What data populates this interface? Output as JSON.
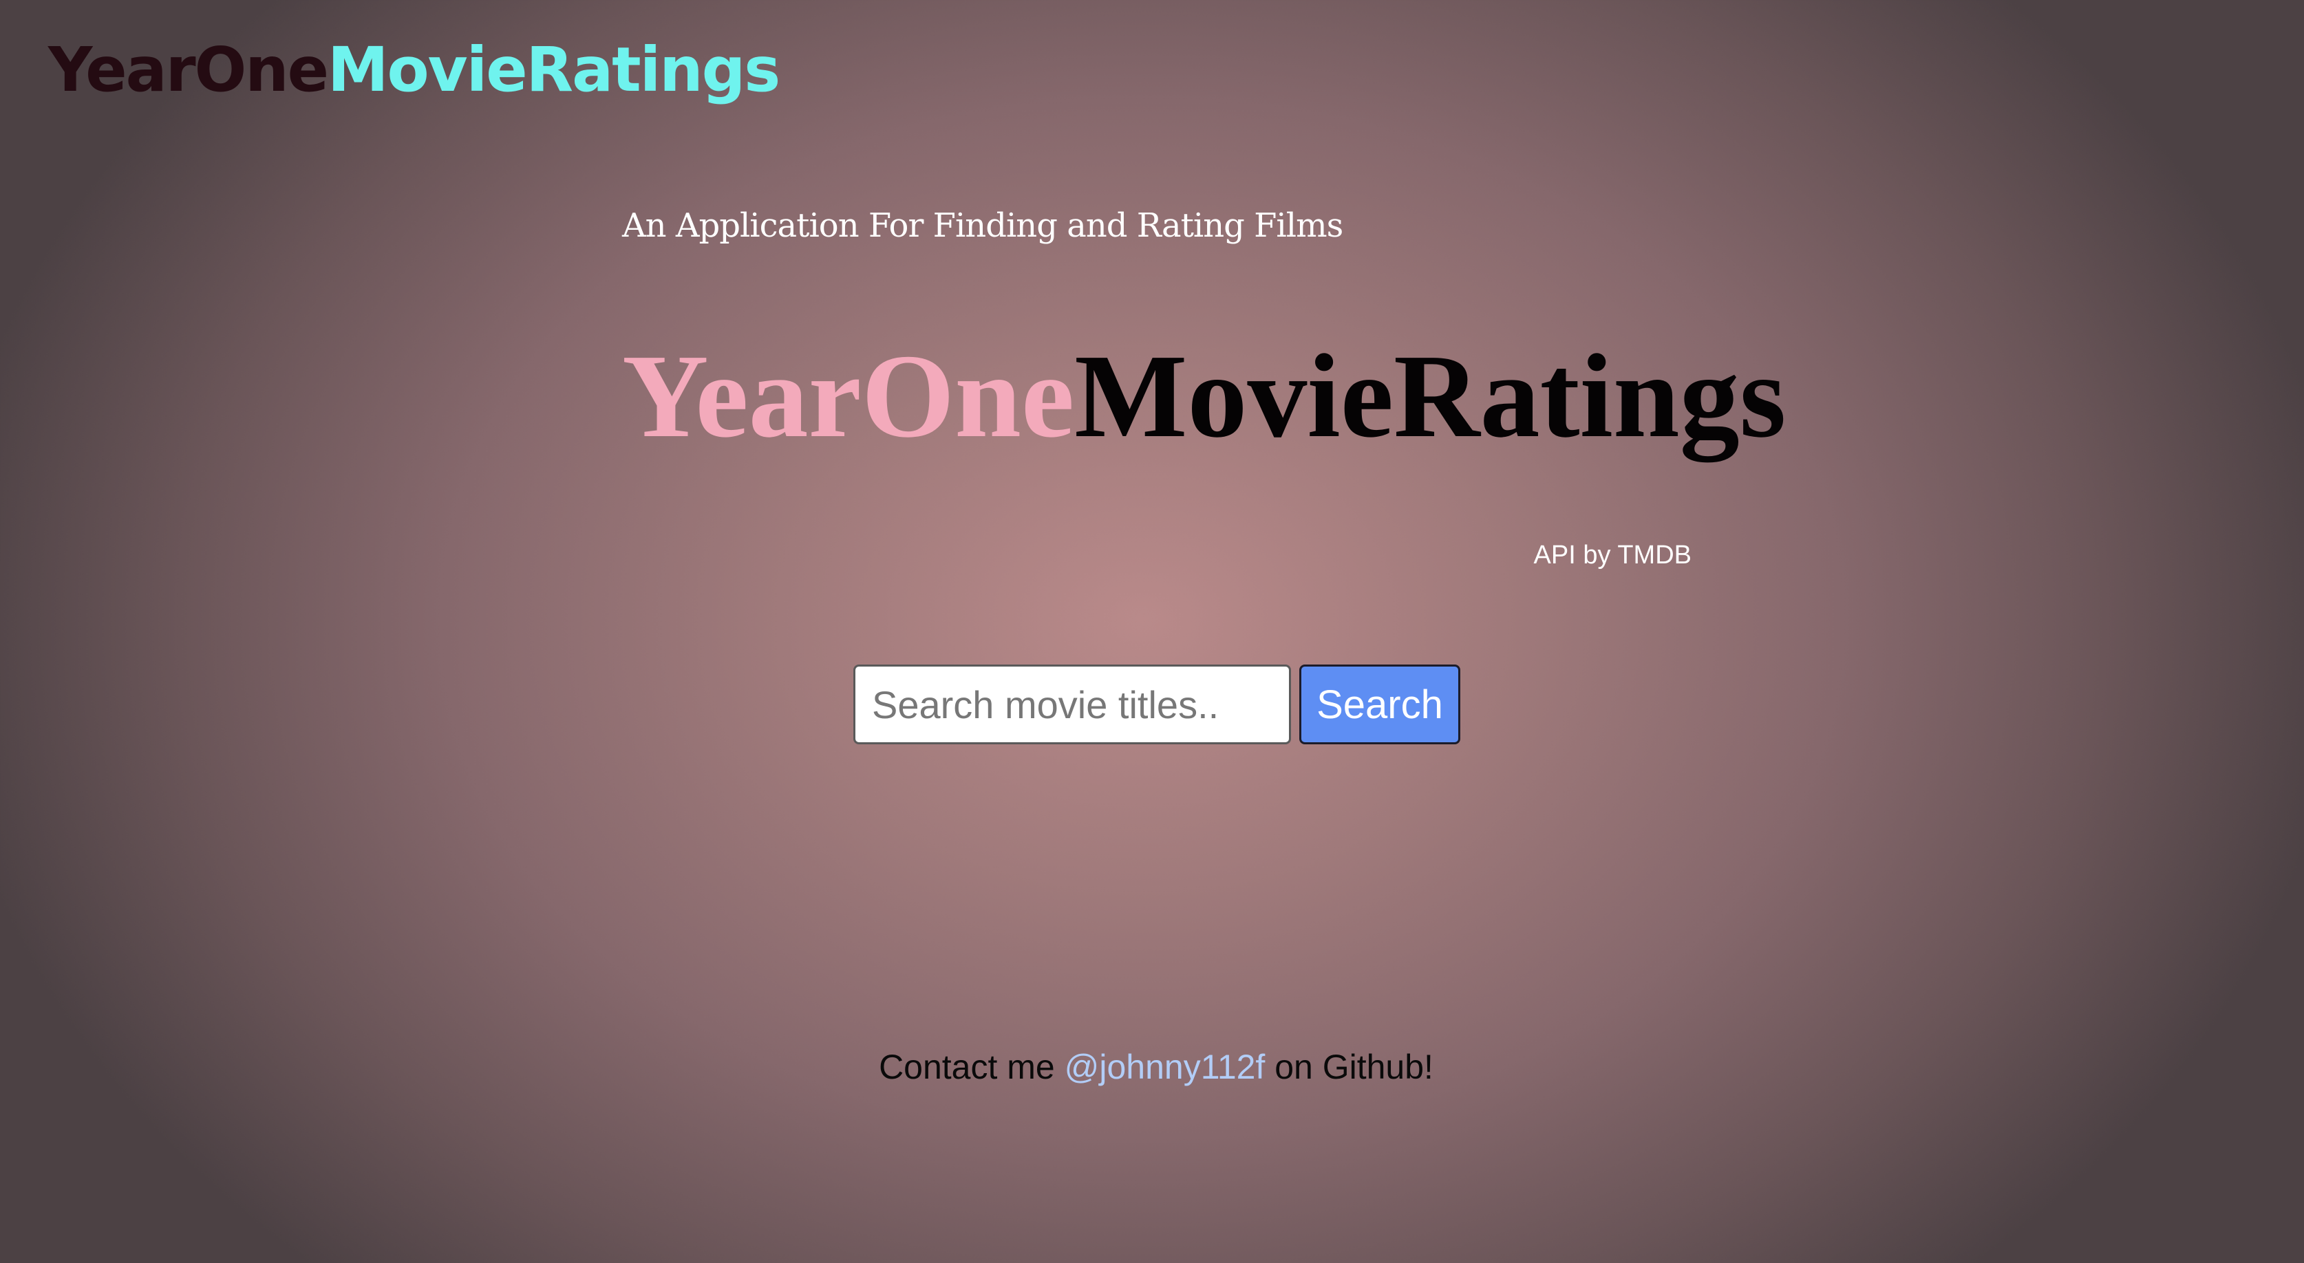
{
  "nav": {
    "logo_part1": "YearOne",
    "logo_part2": "MovieRatings"
  },
  "hero": {
    "tagline": "An Application For Finding and Rating Films",
    "title_part1": "YearOne",
    "title_part2": "MovieRatings",
    "api_credit": "API by TMDB"
  },
  "search": {
    "placeholder": "Search movie titles..",
    "value": "",
    "button_label": "Search"
  },
  "footer": {
    "prefix": "Contact me ",
    "github_handle": "@johnny112f",
    "suffix": " on Github!"
  },
  "colors": {
    "logo_dark": "#240b12",
    "logo_cyan": "#6ff3ee",
    "hero_pink": "#f3aabb",
    "hero_black": "#050304",
    "button_blue": "#5e8ef3",
    "link_blue": "#b2cdf7"
  }
}
